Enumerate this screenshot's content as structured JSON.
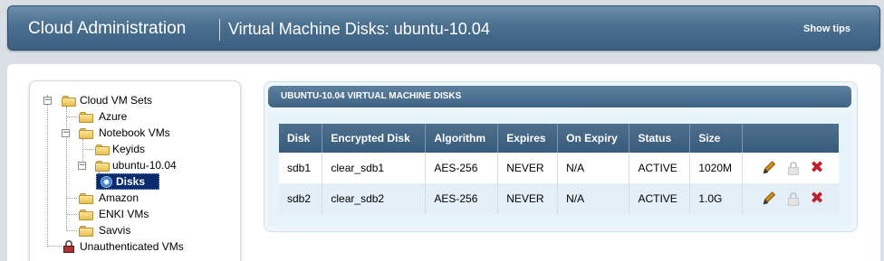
{
  "header": {
    "app_title": "Cloud Administration",
    "page_title": "Virtual Machine Disks: ubuntu-10.04",
    "show_tips": "Show tips"
  },
  "tree": {
    "root": "Cloud VM Sets",
    "azure": "Azure",
    "notebook": "Notebook VMs",
    "keyids": "Keyids",
    "ubuntu": "ubuntu-10.04",
    "disks": "Disks",
    "amazon": "Amazon",
    "enki": "ENKI VMs",
    "savvis": "Savvis",
    "unauth": "Unauthenticated VMs"
  },
  "panel": {
    "title": "UBUNTU-10.04 VIRTUAL MACHINE DISKS",
    "columns": [
      "Disk",
      "Encrypted Disk",
      "Algorithm",
      "Expires",
      "On Expiry",
      "Status",
      "Size",
      ""
    ],
    "rows": [
      {
        "disk": "sdb1",
        "encrypted": "clear_sdb1",
        "algorithm": "AES-256",
        "expires": "NEVER",
        "on_expiry": "N/A",
        "status": "ACTIVE",
        "size": "1020M"
      },
      {
        "disk": "sdb2",
        "encrypted": "clear_sdb2",
        "algorithm": "AES-256",
        "expires": "NEVER",
        "on_expiry": "N/A",
        "status": "ACTIVE",
        "size": "1.0G"
      }
    ]
  },
  "icons": {
    "edit": "pencil-icon",
    "lock": "lock-icon",
    "delete": "delete-icon",
    "folder": "folder-icon",
    "disk": "disk-icon"
  },
  "colors": {
    "header_blue": "#4b6f8f",
    "selected_node": "#0a2b6e",
    "delete_red": "#c0202a"
  }
}
